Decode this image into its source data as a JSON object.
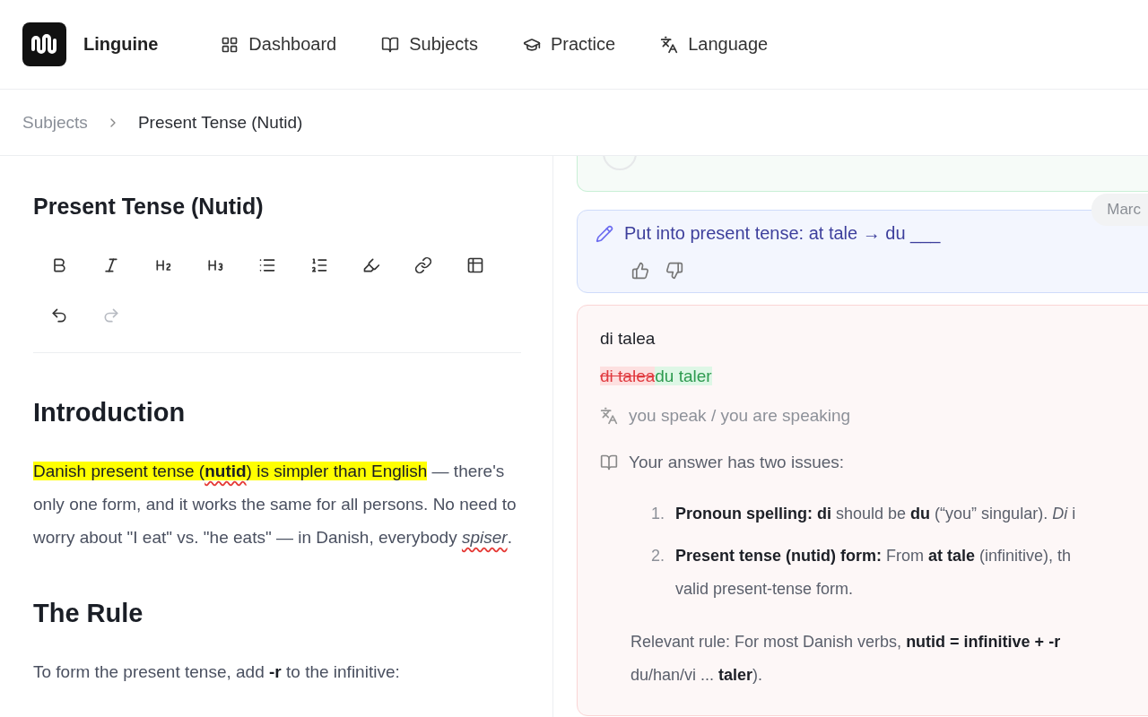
{
  "brand": {
    "name": "Linguine"
  },
  "nav": [
    {
      "kind": "dashboard",
      "label": "Dashboard"
    },
    {
      "kind": "subjects",
      "label": "Subjects"
    },
    {
      "kind": "practice",
      "label": "Practice"
    },
    {
      "kind": "language",
      "label": "Language"
    }
  ],
  "breadcrumb": [
    {
      "label": "Subjects",
      "current": false
    },
    {
      "label": "Present Tense (Nutid)",
      "current": true
    }
  ],
  "editor": {
    "title": "Present Tense (Nutid)",
    "tools": [
      {
        "kind": "bold",
        "disabled": false
      },
      {
        "kind": "italic",
        "disabled": false
      },
      {
        "kind": "h2",
        "disabled": false
      },
      {
        "kind": "h3",
        "disabled": false
      },
      {
        "kind": "bullets",
        "disabled": false
      },
      {
        "kind": "numbers",
        "disabled": false
      },
      {
        "kind": "highlight",
        "disabled": false
      },
      {
        "kind": "link",
        "disabled": false
      },
      {
        "kind": "table",
        "disabled": false
      },
      {
        "kind": "undo",
        "disabled": false
      },
      {
        "kind": "redo",
        "disabled": true
      }
    ],
    "blocks": [
      {
        "kind": "heading",
        "text": "Introduction"
      },
      {
        "kind": "paragraph",
        "segments": [
          {
            "kind": "highlight",
            "text": "Danish present tense ("
          },
          {
            "kind": "highlight-misspelled",
            "text": "**nutid**"
          },
          {
            "kind": "highlight",
            "text": ") is simpler than English"
          },
          {
            "kind": "plain",
            "text": " — there's only one form, and it works the same for all persons. No need to worry about \"I eat\" vs. \"he eats\" — in Danish, everybody "
          },
          {
            "kind": "misspelled",
            "text": "*spiser*"
          },
          {
            "kind": "plain",
            "text": "."
          }
        ]
      },
      {
        "kind": "heading",
        "text": "The Rule"
      },
      {
        "kind": "paragraph",
        "segments": [
          {
            "kind": "plain",
            "text": "To form the present tense, add **-r** to the infinitive:"
          }
        ]
      }
    ]
  },
  "feed": {
    "date": "Marc",
    "exercise": {
      "prompt": "Put into present tense: at tale → du ___"
    },
    "answer": {
      "text": "di talea",
      "diff": [
        {
          "kind": "deleted",
          "text": "di talea"
        },
        {
          "kind": "inserted",
          "text": "du taler"
        }
      ],
      "translation": "you speak / you are speaking",
      "explanation_intro": "Your answer has two issues:",
      "issues": [
        {
          "number": "1.",
          "lines": [
            "**Pronoun spelling: di** should be **du** (“you” singular). *Di* i"
          ]
        },
        {
          "number": "2.",
          "lines": [
            "**Present tense (nutid) form:** From **at tale** (infinitive), th",
            "valid present-tense form."
          ]
        }
      ],
      "rule_lines": [
        "Relevant rule: For most Danish verbs, **nutid = infinitive + -r**",
        "du/han/vi ... **taler**)."
      ]
    }
  }
}
